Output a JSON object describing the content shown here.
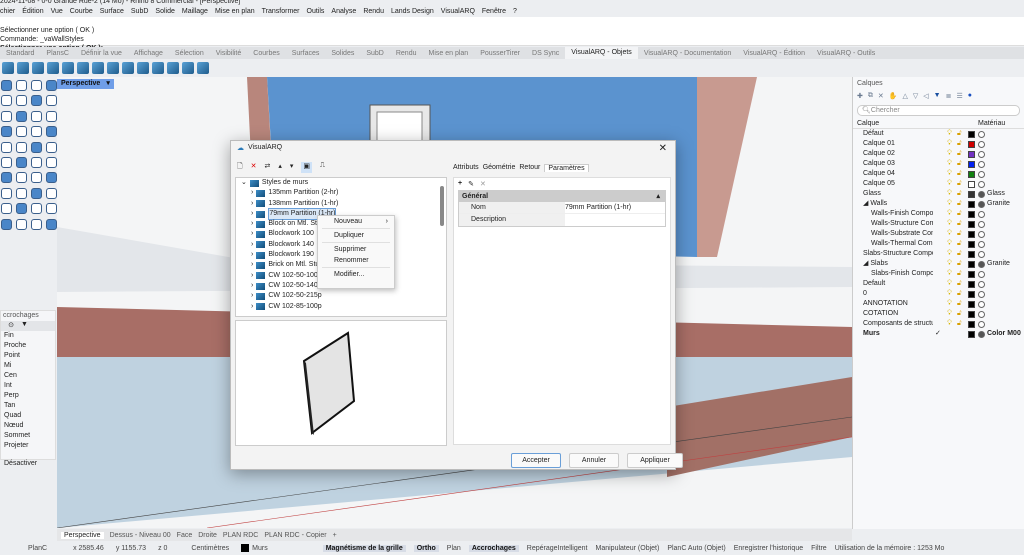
{
  "window": {
    "title": "2024-11-08 - 0-0 Grande Rue-2 (14 Mo) - Rhino 8 Commercial - [Perspective]"
  },
  "menu": [
    "chier",
    "Édition",
    "Vue",
    "Courbe",
    "Surface",
    "SubD",
    "Solide",
    "Maillage",
    "Mise en plan",
    "Transformer",
    "Outils",
    "Analyse",
    "Rendu",
    "Lands Design",
    "VisualARQ",
    "Fenêtre",
    "?"
  ],
  "command": {
    "lines": [
      "Sélectionner une option ( OK )",
      "Commande: _vaWallStyles"
    ],
    "prompt": "Sélectionner une option ( OK ):"
  },
  "toolbar_tabs": [
    "Standard",
    "PlansC",
    "Définir la vue",
    "Affichage",
    "Sélection",
    "Visibilité",
    "Courbes",
    "Surfaces",
    "Solides",
    "SubD",
    "Rendu",
    "Mise en plan",
    "PousserTirer",
    "DS Sync",
    "VisualARQ - Objets",
    "VisualARQ - Documentation",
    "VisualARQ - Édition",
    "VisualARQ - Outils"
  ],
  "active_toolbar_tab": "VisualARQ - Objets",
  "viewport": {
    "label": "Perspective",
    "tabs": [
      "Perspective",
      "Dessus - Niveau 00",
      "Face",
      "Droite",
      "PLAN RDC",
      "PLAN RDC - Copier",
      "+"
    ]
  },
  "snaps": {
    "title": "ccrochages",
    "items": [
      "Fin",
      "Proche",
      "Point",
      "Mi",
      "Cen",
      "Int",
      "Perp",
      "Tan",
      "Quad",
      "Nœud",
      "Sommet",
      "Projeter"
    ],
    "disable": "Désactiver"
  },
  "dialog": {
    "title": "VisualARQ",
    "tree_root": "Styles de murs",
    "styles": [
      "135mm Partition (2-hr)",
      "138mm Partition (1-hr)",
      "79mm Partition (1-hr)",
      "Block on Mtl. Stud",
      "Blockwork 100",
      "Blockwork 140",
      "Blockwork 190",
      "Brick on Mtl. Stud",
      "CW 102-50-100p",
      "CW 102-50-140p",
      "CW 102-50-215p",
      "CW 102-85-100p"
    ],
    "selected": "79mm Partition (1-hr)",
    "context_menu": [
      "Nouveau",
      "Dupliquer",
      "Supprimer",
      "Renommer",
      "Modifier..."
    ],
    "tabs": [
      "Attributs",
      "Géométrie",
      "Retour",
      "Paramètres"
    ],
    "active_tab": "Paramètres",
    "section": "Général",
    "props": [
      {
        "k": "Nom",
        "v": "79mm Partition (1-hr)"
      },
      {
        "k": "Description",
        "v": ""
      }
    ],
    "buttons": {
      "accept": "Accepter",
      "cancel": "Annuler",
      "apply": "Appliquer"
    }
  },
  "layers": {
    "title": "Calques",
    "search_placeholder": "Chercher",
    "col_layer": "Calque",
    "col_material": "Matériau",
    "rows": [
      {
        "name": "Défaut",
        "color": "#000000",
        "mat": ""
      },
      {
        "name": "Calque 01",
        "color": "#d00000",
        "mat": ""
      },
      {
        "name": "Calque 02",
        "color": "#7030c0",
        "mat": ""
      },
      {
        "name": "Calque 03",
        "color": "#0020f0",
        "mat": ""
      },
      {
        "name": "Calque 04",
        "color": "#108010",
        "mat": ""
      },
      {
        "name": "Calque 05",
        "color": "#ffffff",
        "mat": ""
      },
      {
        "name": "Glass",
        "color": "#333333",
        "mat": "Glass"
      },
      {
        "name": "◢ Walls",
        "color": "#000000",
        "mat": "Granite"
      },
      {
        "name": "Walls-Finish Compor",
        "color": "#000000",
        "mat": "",
        "indent": true
      },
      {
        "name": "Walls-Structure Comp",
        "color": "#000000",
        "mat": "",
        "indent": true
      },
      {
        "name": "Walls-Substrate Com",
        "color": "#000000",
        "mat": "",
        "indent": true
      },
      {
        "name": "Walls-Thermal Comp",
        "color": "#000000",
        "mat": "",
        "indent": true
      },
      {
        "name": "Slabs-Structure Compor",
        "color": "#000000",
        "mat": ""
      },
      {
        "name": "◢ Slabs",
        "color": "#000000",
        "mat": "Granite"
      },
      {
        "name": "Slabs-Finish Compor",
        "color": "#000000",
        "mat": "",
        "indent": true
      },
      {
        "name": "Default",
        "color": "#000000",
        "mat": ""
      },
      {
        "name": "0",
        "color": "#000000",
        "mat": ""
      },
      {
        "name": "ANNOTATION",
        "color": "#000000",
        "mat": ""
      },
      {
        "name": "COTATION",
        "color": "#000000",
        "mat": ""
      },
      {
        "name": "Composants de structur",
        "color": "#000000",
        "mat": ""
      },
      {
        "name": "Murs",
        "color": "#000000",
        "mat": "Color M00",
        "current": true
      }
    ]
  },
  "status": {
    "plane": "PlanC",
    "x": "x 2585.46",
    "y": "y 1155.73",
    "z": "z 0",
    "units": "Centimètres",
    "layer": "Murs",
    "toggles": [
      {
        "t": "Magnétisme de la grille",
        "on": true
      },
      {
        "t": "Ortho",
        "on": true
      },
      {
        "t": "Plan",
        "on": false
      },
      {
        "t": "Accrochages",
        "on": true
      },
      {
        "t": "RepérageIntelligent",
        "on": false
      },
      {
        "t": "Manipulateur (Objet)",
        "on": false
      },
      {
        "t": "PlanC Auto (Objet)",
        "on": false
      },
      {
        "t": "Enregistrer l'historique",
        "on": false
      },
      {
        "t": "Filtre",
        "on": false
      }
    ],
    "memory": "Utilisation de la mémoire : 1253 Mo"
  }
}
